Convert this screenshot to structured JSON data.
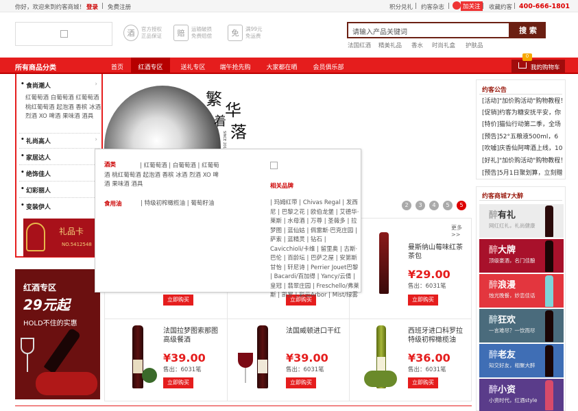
{
  "topbar": {
    "welcome": "你好，欢迎来到约客商城！",
    "login": "登录",
    "sep": "|",
    "register": "免费注册",
    "points": "积分兑礼",
    "magazine": "约客杂志",
    "follow": "加关注",
    "collect": "收藏约客",
    "hotline": "400-666-1801"
  },
  "guarantees": [
    {
      "icon": "酒",
      "line1": "官方授权",
      "line2": "正品保证"
    },
    {
      "icon": "赔",
      "line1": "运输破损",
      "line2": "免费赔偿"
    },
    {
      "icon": "免",
      "line1": "满99元",
      "line2": "免运费"
    }
  ],
  "search": {
    "placeholder": "请输入产品关键词",
    "button": "搜 索",
    "hot": [
      "法国红酒",
      "精美礼品",
      "香水",
      "时尚礼盒",
      "护肤品"
    ]
  },
  "nav": {
    "all": "所有商品分类",
    "items": [
      "首页",
      "红酒专区",
      "送礼专区",
      "端午抢先购",
      "大家都在晒",
      "会员俱乐部"
    ],
    "cart": "我的购物车",
    "cart_count": "0"
  },
  "categories": [
    {
      "title": "食尚潮人",
      "sub": "红葡萄酒  白葡萄酒  红葡萄酒  桃红葡萄酒  起泡酒  香槟  冰酒  烈酒  XO  啤酒  果味酒  酒具"
    },
    {
      "title": "礼尚高人"
    },
    {
      "title": "家居达人"
    },
    {
      "title": "绝饰佳人"
    },
    {
      "title": "幻彩丽人"
    },
    {
      "title": "变装伊人"
    }
  ],
  "gift_card": {
    "title": "礼品卡",
    "number": "NO.5412548"
  },
  "banner": {
    "text1": "繁",
    "text2": "华",
    "text3": "着",
    "text4": "落",
    "side": "SINCE 2011"
  },
  "popup": {
    "cat1": "酒类",
    "cat1_items": "| 红葡萄酒  | 白葡萄酒  | 红葡萄酒  桃红葡萄酒  起泡酒  香槟  冰酒  烈酒  XO  啤酒  果味酒  酒具",
    "cat2": "食用油",
    "cat2_items": "| 特级初榨橄榄油  | 葡萄籽油",
    "brands_title": "相关品牌",
    "brands": "| 玛姆红带  | Chivas Regal  | 发西尼  | 巴黎之花  | 欧伯龙堡  | 艾德华·莱斯  | 水母酒  | 万尊  | 圣薇多  | 拉梦图  | 蓝仙姑  | 佩雷斯·巴克庄园  | 萨索  | 蓝精灵  | 钻石  | Cavicchioli/卡维  | 留里奥  | 古斯·巴伦  | 百龄坛  | 巴萨之屋  | 安第斯甘怡  | 轩尼诗  | Perrier Jouet巴黎  | Bacardi/百加得  | Yancy/云倩  | 皇冠  | 翡翠庄园  | Freschello/弗莱斯  | 凯罗  | 彩云Arbor  | Mist/绿雾"
  },
  "slider": {
    "dots": [
      "2",
      "3",
      "4",
      "5"
    ]
  },
  "more": "更多>>",
  "promo": {
    "title": "红酒专区",
    "price": "29元起",
    "slogan": "HOLD不住的实惠"
  },
  "products": [
    {
      "name": "曼斯纳山莓味红茶茶包",
      "price": "¥29.00",
      "sold": "售出：6031笔",
      "btn": "立即购买"
    },
    {
      "name": "",
      "price": "",
      "sold": "",
      "btn": "立即购买"
    },
    {
      "name": "",
      "price": "",
      "sold": "",
      "btn": "立即购买"
    },
    {
      "name": "法国拉梦图索那图高级餐酒",
      "price": "¥39.00",
      "sold": "售出：6031笔",
      "btn": "立即购买"
    },
    {
      "name": "法国威顿进口干红",
      "price": "¥39.00",
      "sold": "售出：6031笔",
      "btn": "立即购买"
    },
    {
      "name": "西班牙进口科罗拉特级初榨橄榄油",
      "price": "¥36.00",
      "sold": "售出：6031笔",
      "btn": "立即购买"
    },
    {
      "name": "",
      "price": "¥29.00",
      "sold": "售出：6031笔",
      "btn": "立即购买"
    }
  ],
  "notice": {
    "title": "约客公告",
    "items": [
      "[活动]\"加价购活动\"购物教程！",
      "[促销]约客为糖安抚平安，你",
      "[特价]猫仙行动第二季，全场",
      "[预告]52°五粮液500ml，6",
      "[吹噱]庆香仙阿啤酒上线，10",
      "[好礼]\"加价购活动\"购物教程！",
      "[预告]5月1日聚划算，立刻赠"
    ]
  },
  "brands": {
    "title": "约客商城7大醉",
    "items": [
      {
        "big": "有礼",
        "small": "网红红礼，礼尚健康",
        "color": "#e8e8e8",
        "dark": true
      },
      {
        "big": "大牌",
        "small": "顶级豪酒，名门佳酿",
        "color": "#a8112b"
      },
      {
        "big": "浪漫",
        "small": "烛光晚餐，妙恋佳话",
        "color": "#e3363e"
      },
      {
        "big": "狂欢",
        "small": "一言难尽？一饮而尽",
        "color": "#4a6b7c"
      },
      {
        "big": "老友",
        "small": "知交好友，相聚大醉",
        "color": "#3f6eb5"
      },
      {
        "big": "小资",
        "small": "小资时代，红酒style",
        "color": "#5a3c8a"
      }
    ],
    "zui": "醉"
  },
  "colors": {
    "accent": "#e51d1d",
    "dark": "#6b1f12"
  }
}
